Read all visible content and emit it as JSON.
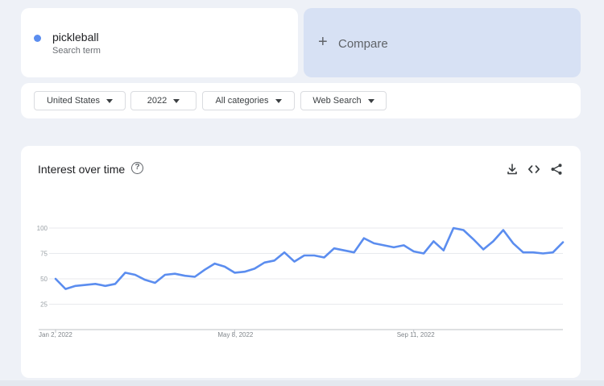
{
  "search_term": {
    "name": "pickleball",
    "subtitle": "Search term",
    "dot_color": "#5b8def"
  },
  "compare": {
    "label": "Compare"
  },
  "filters": {
    "country": "United States",
    "year": "2022",
    "category": "All categories",
    "search_type": "Web Search"
  },
  "chart_section": {
    "title": "Interest over time",
    "icons": [
      "help-icon",
      "download-icon",
      "embed-icon",
      "share-icon"
    ]
  },
  "chart_data": {
    "type": "line",
    "title": "Interest over time",
    "xlabel": "",
    "ylabel": "",
    "ylim": [
      0,
      100
    ],
    "yticks": [
      25,
      50,
      75,
      100
    ],
    "xtick_labels": [
      "Jan 2, 2022",
      "May 8, 2022",
      "Sep 11, 2022"
    ],
    "xtick_index": [
      0,
      18,
      36
    ],
    "grid": true,
    "line_color": "#5b8def",
    "series": [
      {
        "values": [
          50,
          40,
          43,
          44,
          45,
          43,
          45,
          56,
          54,
          49,
          46,
          54,
          55,
          53,
          52,
          59,
          65,
          62,
          56,
          57,
          60,
          66,
          68,
          76,
          67,
          73,
          73,
          71,
          80,
          78,
          76,
          90,
          85,
          83,
          81,
          83,
          77,
          75,
          87,
          78,
          100,
          98,
          89,
          79,
          87,
          98,
          85,
          76,
          76,
          75,
          76,
          86
        ]
      }
    ]
  }
}
